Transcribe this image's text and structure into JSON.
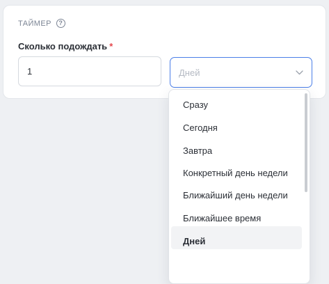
{
  "section": {
    "title": "ТАЙМЕР",
    "help_icon": "question-circle-icon"
  },
  "field": {
    "label": "Сколько подождать",
    "required_mark": "*",
    "value": "1"
  },
  "select": {
    "placeholder": "Дней",
    "icon": "chevron-down-icon"
  },
  "dropdown": {
    "options": [
      "Сразу",
      "Сегодня",
      "Завтра",
      "Конкретный день недели",
      "Ближайший день недели",
      "Ближайшее время",
      "Дней"
    ]
  },
  "colors": {
    "accent": "#4a7ee8",
    "required": "#e5484d",
    "text": "#2b2f36",
    "muted": "#7b8494"
  }
}
